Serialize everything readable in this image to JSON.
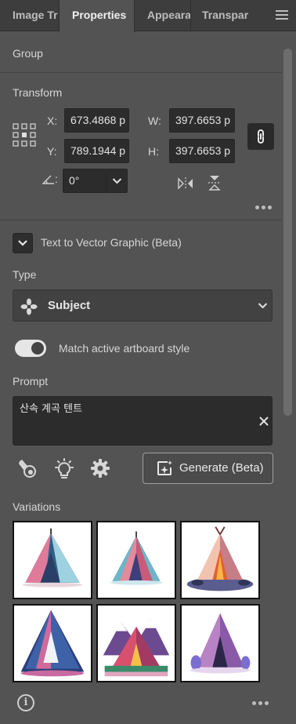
{
  "tabs": [
    {
      "label": "Image Tr",
      "active": false
    },
    {
      "label": "Properties",
      "active": true
    },
    {
      "label": "Appeara",
      "active": false
    },
    {
      "label": "Transpar",
      "active": false
    }
  ],
  "group": {
    "title": "Group"
  },
  "transform": {
    "title": "Transform",
    "x_label": "X:",
    "x_value": "673.4868 p",
    "y_label": "Y:",
    "y_value": "789.1944 p",
    "w_label": "W:",
    "w_value": "397.6653 p",
    "h_label": "H:",
    "h_value": "397.6653 p",
    "angle_label": ":",
    "angle_value": "0°"
  },
  "text_to_vector": {
    "title": "Text to Vector Graphic (Beta)",
    "type_label": "Type",
    "type_value": "Subject",
    "toggle_label": "Match active artboard style",
    "toggle_on": true,
    "prompt_label": "Prompt",
    "prompt_value": "산속 계곡 텐트",
    "generate_label": "Generate (Beta)"
  },
  "variations": {
    "title": "Variations",
    "count": 6
  },
  "icons": {
    "menu": "hamburger-menu-icon",
    "link": "link-icon",
    "flip_h": "flip-horizontal-icon",
    "flip_v": "flip-vertical-icon",
    "more": "more-icon",
    "subject": "subject-icon",
    "info": "info-icon"
  },
  "colors": {
    "panel": "#535353",
    "tabbar": "#3d3d3d",
    "field": "#2c2c2c"
  }
}
